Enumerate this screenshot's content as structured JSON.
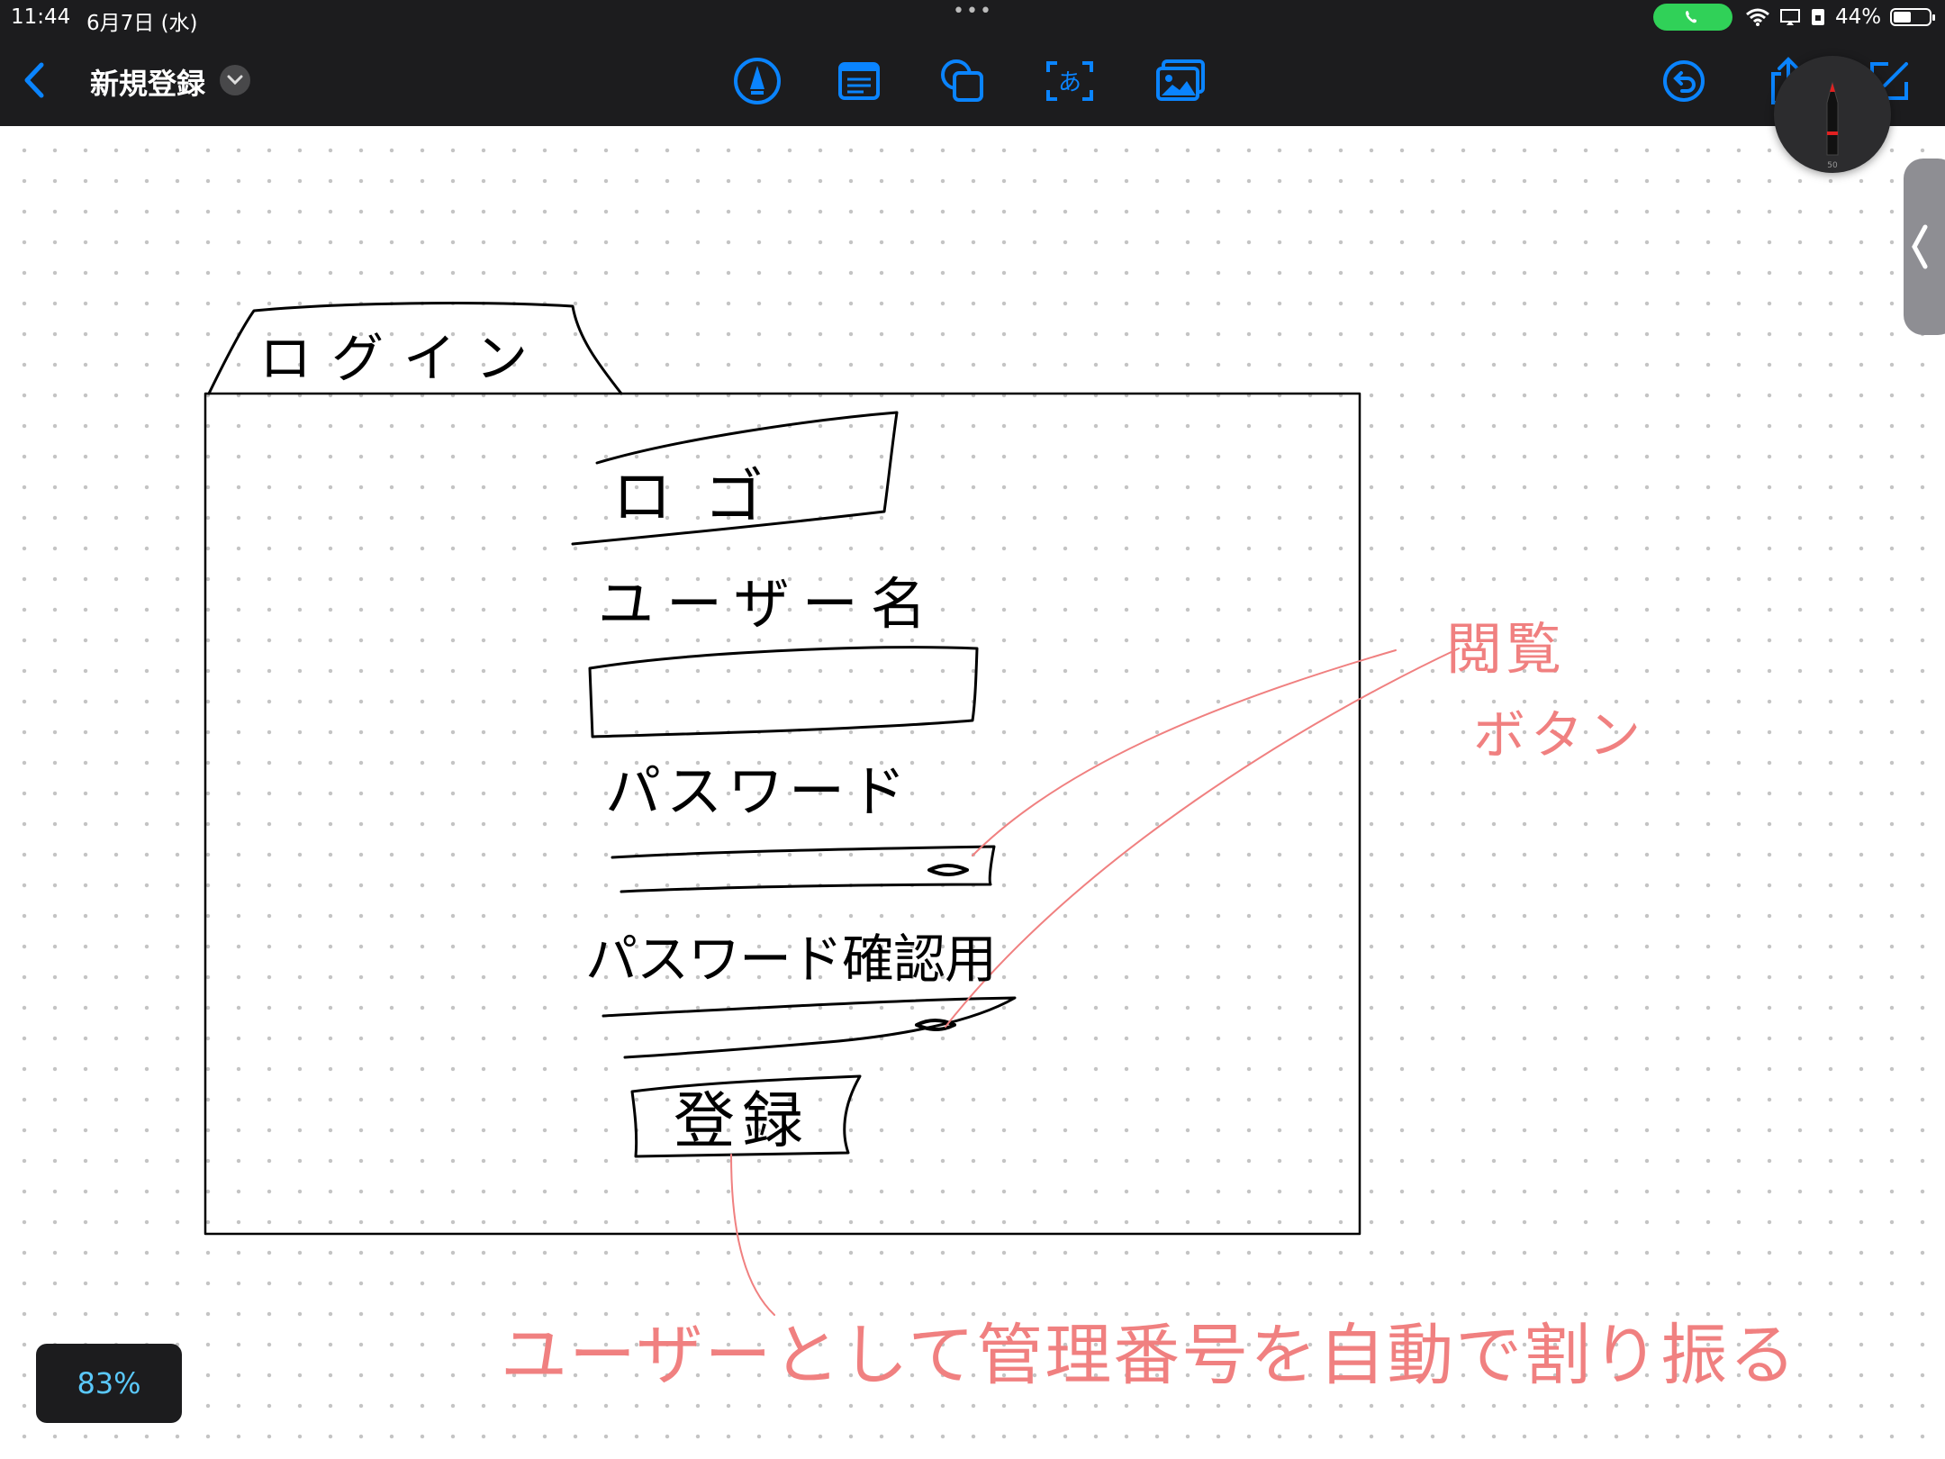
{
  "status_bar": {
    "time": "11:44",
    "date": "6月7日 (水)",
    "battery": "44%"
  },
  "toolbar": {
    "title": "新規登録",
    "tools": [
      {
        "name": "pen-tool-icon"
      },
      {
        "name": "text-box-icon"
      },
      {
        "name": "shapes-icon"
      },
      {
        "name": "ocr-text-icon",
        "glyph": "あ"
      },
      {
        "name": "image-icon"
      }
    ]
  },
  "canvas": {
    "zoom": "83%",
    "handwriting": {
      "tab_label": "ログイン",
      "logo": "ロゴ",
      "username_label": "ユーザー名",
      "password_label": "パスワード",
      "confirm_label": "パスワード確認用",
      "register_button": "登録",
      "annotation_view": "閲覧ボタン",
      "annotation_auto": "ユーザーとして管理番号を自動で割り振る"
    }
  },
  "colors": {
    "toolbar_bg": "#1c1c1e",
    "accent": "#0a84ff",
    "ink_black": "#000000",
    "ink_red": "#f08080",
    "call_green": "#30d158"
  }
}
